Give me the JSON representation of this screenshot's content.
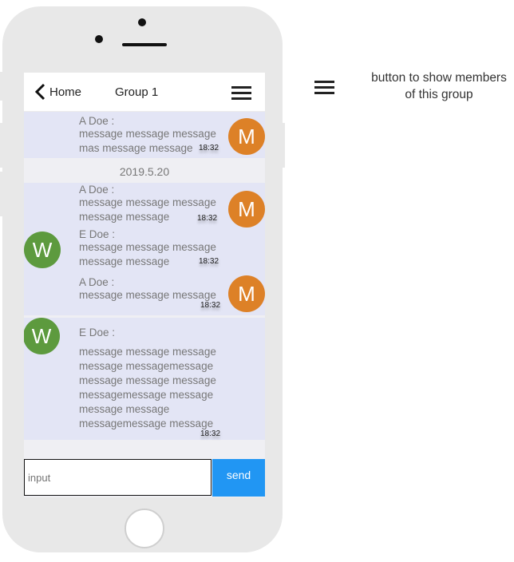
{
  "header": {
    "back_label": "Home",
    "title": "Group 1"
  },
  "date_separator": "2019.5.20",
  "messages": [
    {
      "sender": "A Doe :",
      "text": "message message message\nmas message message",
      "time": "18:32",
      "avatar": "M"
    },
    {
      "sender": "A Doe :",
      "text": "message message message\nmessage message",
      "time": "18:32",
      "avatar": "M"
    },
    {
      "sender": "E Doe :",
      "text": "message message message\nmessage message",
      "time": "18:32",
      "avatar": "W"
    },
    {
      "sender": "A Doe :",
      "text": "message message message",
      "time": "18:32",
      "avatar": "M"
    },
    {
      "sender": "E Doe :",
      "text": "message message message\nmessage messagemessage\nmessage message message\nmessagemessage message\nmessage message\nmessagemessage message",
      "time": "18:32",
      "avatar": "W"
    }
  ],
  "composer": {
    "placeholder": "input",
    "send_label": "send"
  },
  "annotation": {
    "text": "button to show members\nof this group"
  },
  "colors": {
    "avatar_m": "#dd8127",
    "avatar_w": "#5d9a3e",
    "send_button": "#2196f3",
    "message_background": "#e3e5f5"
  },
  "icons": [
    "chevron-left-icon",
    "hamburger-menu-icon"
  ]
}
